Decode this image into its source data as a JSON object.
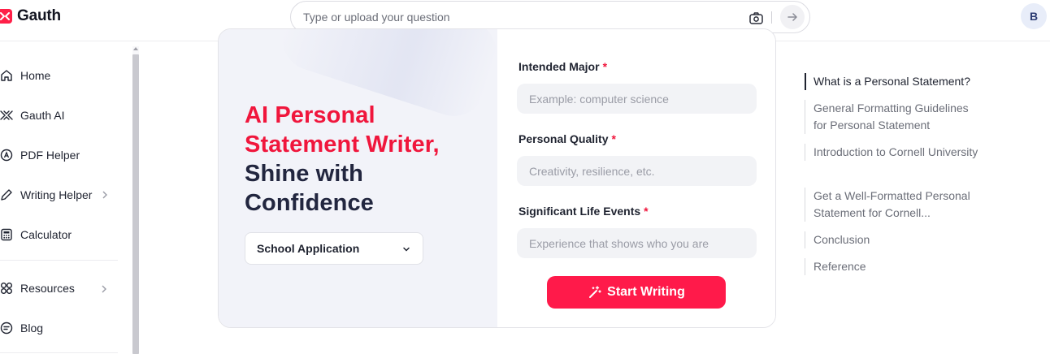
{
  "header": {
    "logo_text": "Gauth",
    "search_placeholder": "Type or upload your question",
    "avatar_initial": "B"
  },
  "sidebar": {
    "items": [
      {
        "label": "Home",
        "icon": "home-icon"
      },
      {
        "label": "Gauth AI",
        "icon": "gauth-ai-icon"
      },
      {
        "label": "PDF Helper",
        "icon": "pdf-icon"
      },
      {
        "label": "Writing Helper",
        "icon": "pen-icon",
        "has_submenu": true
      },
      {
        "label": "Calculator",
        "icon": "calculator-icon"
      },
      {
        "label": "Resources",
        "icon": "grid-icon",
        "has_submenu": true
      },
      {
        "label": "Blog",
        "icon": "blog-icon"
      }
    ]
  },
  "hero": {
    "title_accent_1": "AI Personal",
    "title_accent_2": "Statement Writer,",
    "title_dark_1": "Shine with",
    "title_dark_2": "Confidence",
    "select_value": "School Application"
  },
  "form": {
    "fields": [
      {
        "label": "Intended Major",
        "placeholder": "Example: computer science"
      },
      {
        "label": "Personal Quality",
        "placeholder": "Creativity, resilience, etc."
      },
      {
        "label": "Significant Life Events",
        "placeholder": "Experience that shows who you are"
      }
    ],
    "required_mark": "*",
    "submit_label": "Start Writing"
  },
  "toc": {
    "items": [
      {
        "label": "What is a Personal Statement?",
        "active": true
      },
      {
        "label": "General Formatting Guidelines for Personal Statement",
        "active": false
      },
      {
        "label": "Introduction to Cornell University",
        "active": false
      },
      {
        "label": "Get a Well-Formatted Personal Statement for Cornell...",
        "active": false
      },
      {
        "label": "Conclusion",
        "active": false
      },
      {
        "label": "Reference",
        "active": false
      }
    ]
  },
  "colors": {
    "brand": "#ff1f48",
    "accent_text": "#f0163c",
    "button": "#ff1a4a",
    "dark_text": "#22263f"
  }
}
